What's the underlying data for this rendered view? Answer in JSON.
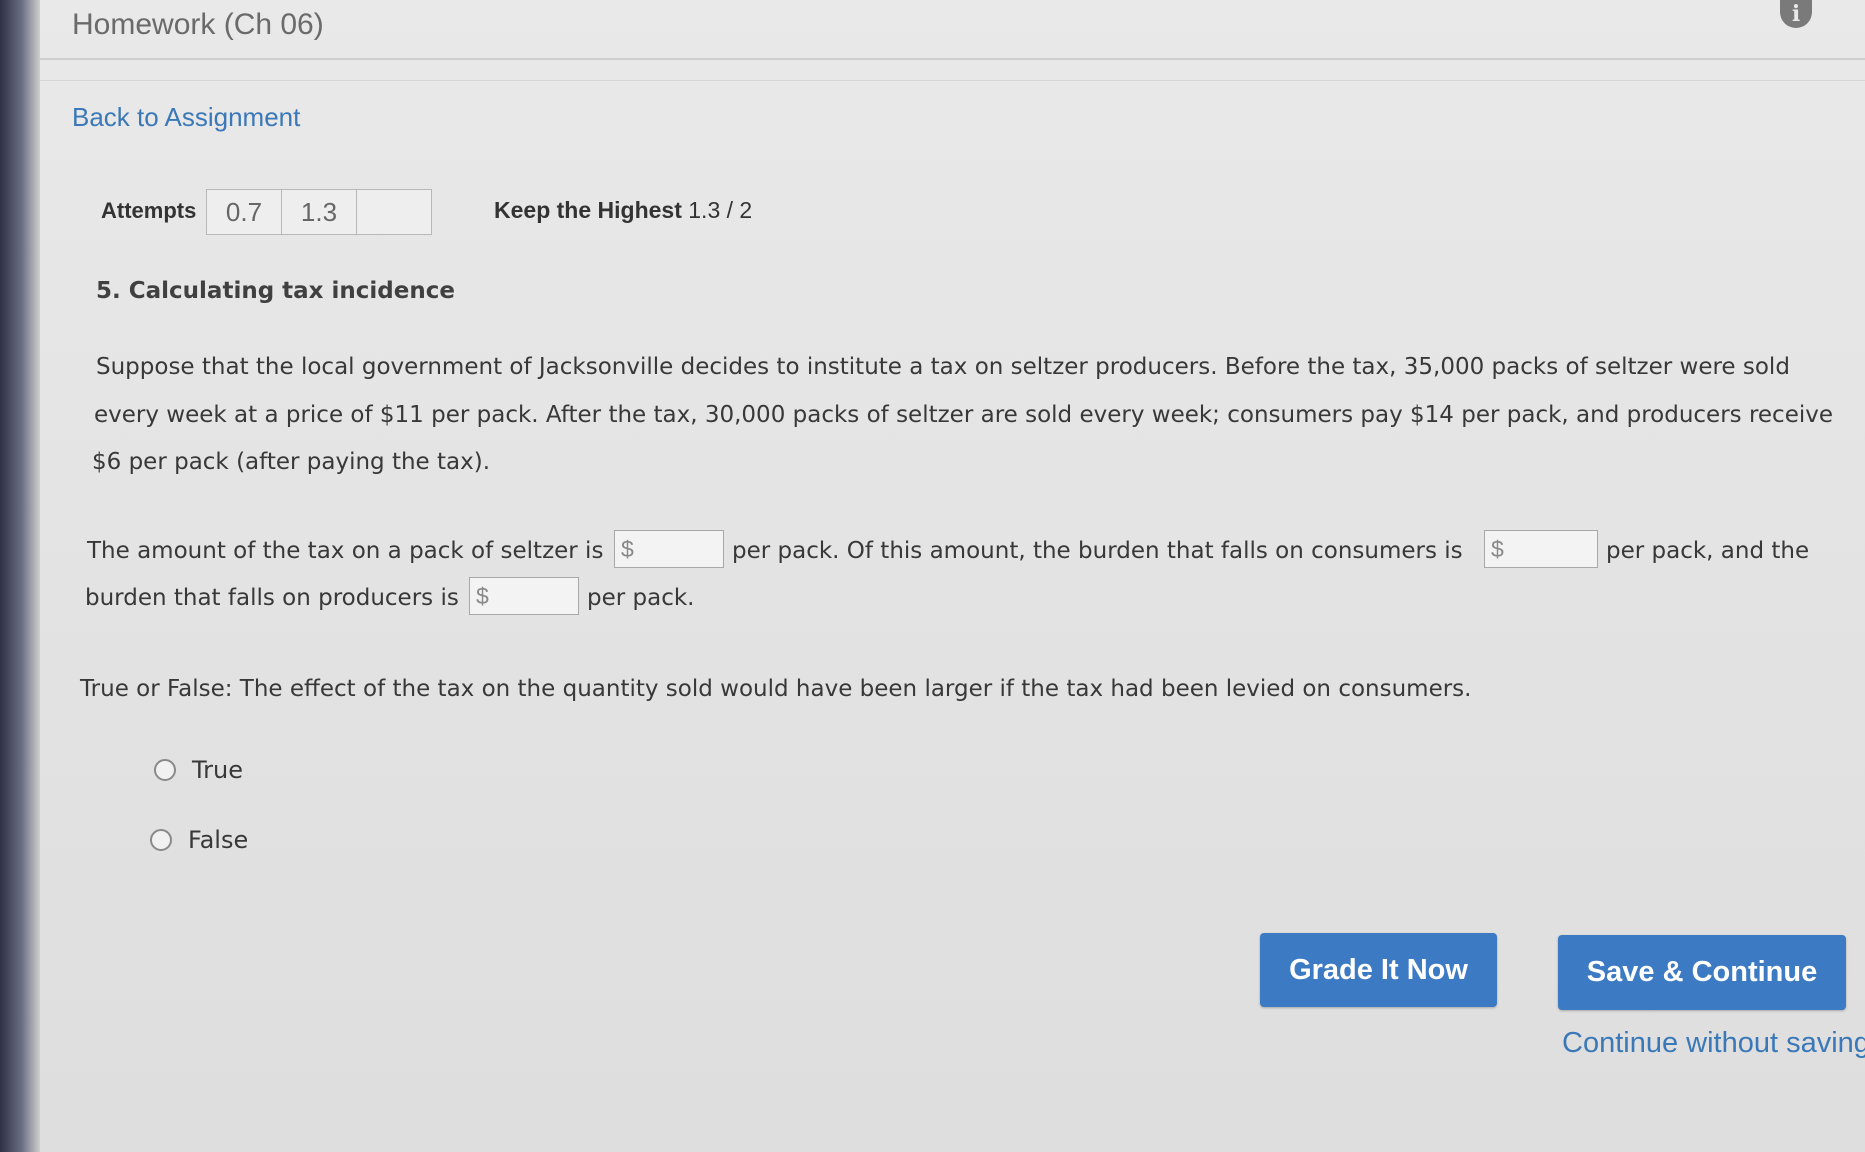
{
  "header": {
    "title": "Homework (Ch 06)",
    "info_icon": "info-icon"
  },
  "back_link": "Back to Assignment",
  "attempts": {
    "label": "Attempts",
    "values": [
      "0.7",
      "1.3",
      ""
    ]
  },
  "keep_highest": {
    "label": "Keep the Highest",
    "value": "1.3 / 2"
  },
  "question": {
    "title": "5. Calculating tax incidence",
    "intro_lines": [
      "Suppose that the local government of Jacksonville decides to institute a tax on seltzer producers. Before the tax, 35,000 packs of seltzer were sold",
      "every week at a price of $11 per pack. After the tax, 30,000 packs of seltzer are sold every week; consumers pay $14 per pack, and producers receive",
      "$6 per pack (after paying the tax)."
    ],
    "fill_in": {
      "seg1": "The amount of the tax on a pack of seltzer is",
      "seg2": "per pack. Of this amount, the burden that falls on consumers is",
      "seg3": "per pack, and the",
      "seg4": "burden that falls on producers is",
      "seg5": "per pack.",
      "input_prefix": "$",
      "inputs": [
        "",
        "",
        ""
      ]
    },
    "tf_prompt": "True or False: The effect of the tax on the quantity sold would have been larger if the tax had been levied on consumers.",
    "options": [
      "True",
      "False"
    ],
    "selected_option": null
  },
  "buttons": {
    "grade": "Grade It Now",
    "save": "Save & Continue",
    "continue_without_saving": "Continue without saving"
  },
  "colors": {
    "accent": "#3d7ac4",
    "link": "#3a78b8",
    "background": "#e6e6e6"
  }
}
